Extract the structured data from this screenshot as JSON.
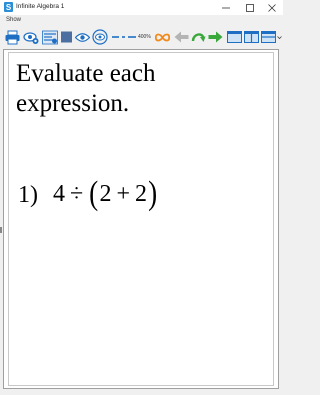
{
  "window": {
    "title": "Infinite Algebra 1",
    "controls": [
      "minimize-icon",
      "maximize-icon",
      "close-icon"
    ]
  },
  "menu": {
    "items": [
      "Show"
    ]
  },
  "toolbar": {
    "zoom_label": "400%",
    "icons": [
      "printer-icon",
      "eye-settings-icon",
      "layout-settings-icon",
      "square-icon",
      "eye-icon",
      "eye-cycle-icon",
      "line-spacing-icon",
      "zoom-level",
      "infinity-icon",
      "back-arrow-icon",
      "undo-icon",
      "forward-arrow-icon",
      "single-page-icon",
      "two-page-icon",
      "stacked-page-icon",
      "overflow-chevron-icon"
    ],
    "colors": {
      "blue": "#1e6fc4",
      "orange": "#f08a1c",
      "green": "#3aa83a",
      "grey": "#b4b4b4"
    }
  },
  "document": {
    "title_line1": "Evaluate each",
    "title_line2": "expression.",
    "problem": {
      "number": "1)",
      "a": "4",
      "op1": "÷",
      "open": "(",
      "b": "2",
      "op2": "+",
      "c": "2",
      "close": ")"
    }
  }
}
